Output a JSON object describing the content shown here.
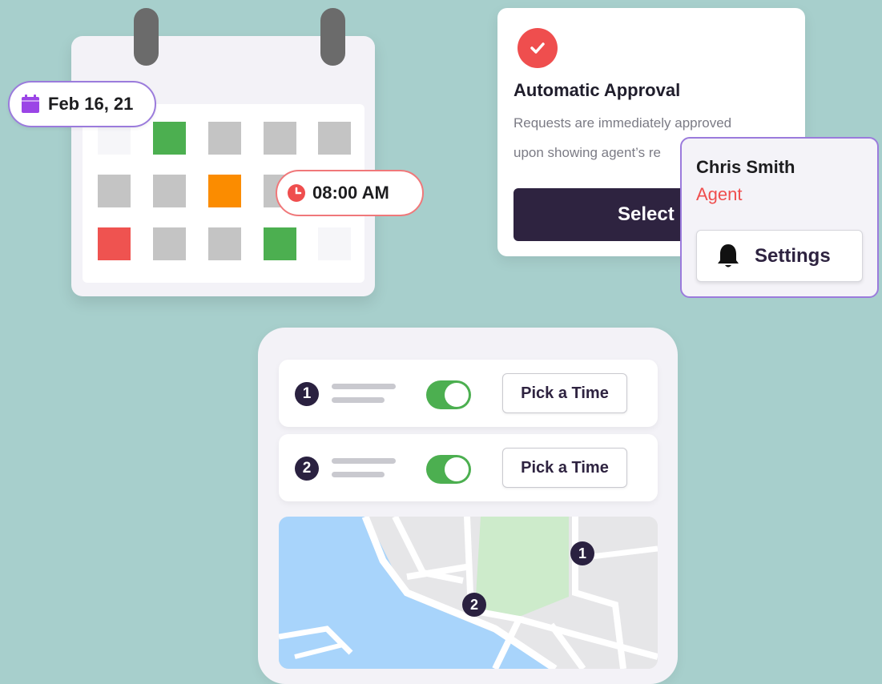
{
  "colors": {
    "background": "#a7cfcc",
    "accent_purple": "#9b7bdc",
    "accent_red": "#ef4e4e",
    "dark": "#2e2340",
    "toggle_green": "#4caf50",
    "cell_green": "#4caf50",
    "cell_orange": "#fb8c00",
    "cell_red": "#ef5350",
    "cell_gray": "#c4c4c4",
    "water": "#a8d4fb",
    "park": "#cdebcb"
  },
  "calendar": {
    "date_label": "Feb 16, 21",
    "date_icon": "calendar-icon",
    "time_label": "08:00 AM",
    "time_icon": "clock-icon",
    "cells": [
      [
        "empty",
        "green",
        "gray",
        "gray",
        "gray"
      ],
      [
        "gray",
        "gray",
        "orange",
        "gray",
        "gray"
      ],
      [
        "red",
        "gray",
        "gray",
        "green",
        "empty"
      ]
    ]
  },
  "approval": {
    "icon": "checkmark-icon",
    "title": "Automatic Approval",
    "description_line1": "Requests are immediately approved",
    "description_line2": "upon showing agent’s re",
    "select_label": "Select"
  },
  "agent": {
    "name": "Chris Smith",
    "role": "Agent",
    "settings_icon": "bell-icon",
    "settings_label": "Settings"
  },
  "schedule": {
    "rows": [
      {
        "number": "1",
        "toggle_on": true,
        "button_label": "Pick a Time"
      },
      {
        "number": "2",
        "toggle_on": true,
        "button_label": "Pick a Time"
      }
    ],
    "map_markers": [
      "1",
      "2"
    ]
  }
}
